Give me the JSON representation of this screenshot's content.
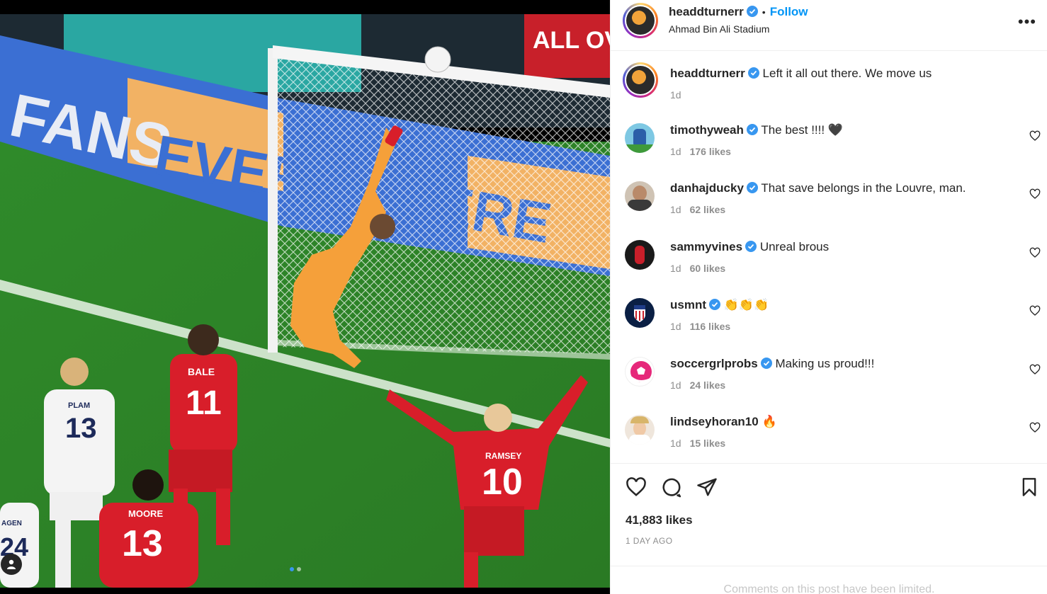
{
  "post": {
    "author": "headdturnerr",
    "follow_label": "Follow",
    "separator": "•",
    "location": "Ahmad Bin Ali Stadium",
    "more_label": "•••",
    "caption": "Left it all out there. We move us",
    "caption_time": "1d",
    "likes": "41,883 likes",
    "age": "1 DAY AGO",
    "comments_limited": "Comments on this post have been limited."
  },
  "photo": {
    "banner_text": "ALL OVE",
    "board_text_1": "FANS",
    "board_text_2": "EVERYWHERE",
    "players": [
      {
        "name": "BALE",
        "number": "11"
      },
      {
        "name": "PLAM",
        "number": "13"
      },
      {
        "name": "MOORE",
        "number": "13"
      },
      {
        "name": "RAMSEY",
        "number": "10"
      },
      {
        "name": "AGEN",
        "number": "24"
      }
    ],
    "carousel": {
      "count": 2,
      "active": 1
    }
  },
  "comments": [
    {
      "user": "timothyweah",
      "text": "The best !!!! 🖤",
      "time": "1d",
      "likes": "176 likes",
      "avatar_color": "#7ec8e3"
    },
    {
      "user": "danhajducky",
      "text": "That save belongs in the Louvre, man.",
      "time": "1d",
      "likes": "62 likes",
      "avatar_color": "#5a4a3a"
    },
    {
      "user": "sammyvines",
      "text": "Unreal brous",
      "time": "1d",
      "likes": "60 likes",
      "avatar_color": "#1a1a1a"
    },
    {
      "user": "usmnt",
      "text": "👏👏👏",
      "time": "1d",
      "likes": "116 likes",
      "avatar_color": "#0a1f44"
    },
    {
      "user": "soccergrlprobs",
      "text": "Making us proud!!!",
      "time": "1d",
      "likes": "24 likes",
      "avatar_color": "#e6287a"
    },
    {
      "user": "lindseyhoran10",
      "text": "🔥",
      "time": "1d",
      "likes": "15 likes",
      "avatar_color": "#d9c7b8"
    }
  ],
  "colors": {
    "accent": "#0095f6",
    "verified": "#3897f0",
    "muted": "#8e8e8e",
    "wales_red": "#d81e2a",
    "keeper_orange": "#f5a03a"
  }
}
